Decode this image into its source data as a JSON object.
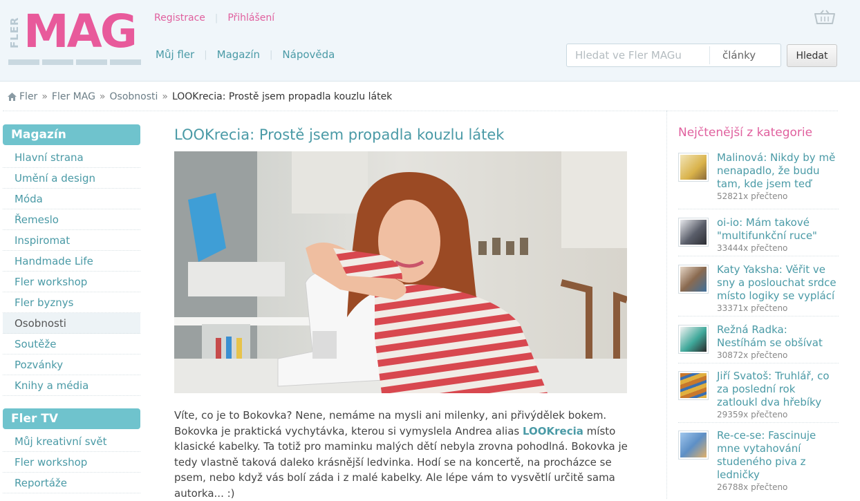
{
  "logo": {
    "small": "FLER",
    "big": "MAG"
  },
  "header": {
    "top_links": [
      "Registrace",
      "Přihlášení"
    ],
    "nav": [
      "Můj fler",
      "Magazín",
      "Nápověda"
    ],
    "search_placeholder": "Hledat ve Fler MAGu",
    "search_scope": "články",
    "search_button": "Hledat",
    "cart_icon": "basket-icon"
  },
  "breadcrumb": {
    "items": [
      "Fler",
      "Fler MAG",
      "Osobnosti"
    ],
    "current": "LOOKrecia: Prostě jsem propadla kouzlu látek",
    "separator": "»"
  },
  "sidebar": {
    "magazine": {
      "title": "Magazín",
      "items": [
        "Hlavní strana",
        "Umění a design",
        "Móda",
        "Řemeslo",
        "Inspiromat",
        "Handmade Life",
        "Fler workshop",
        "Fler byznys",
        "Osobnosti",
        "Soutěže",
        "Pozvánky",
        "Knihy a média"
      ],
      "active": "Osobnosti"
    },
    "tv": {
      "title": "Fler TV",
      "items": [
        "Můj kreativní svět",
        "Fler workshop",
        "Reportáže"
      ]
    }
  },
  "article": {
    "title": "LOOKrecia: Prostě jsem propadla kouzlu látek",
    "body_1": "Víte, co je to Bokovka? Nene, nemáme na mysli ani milenky, ani přivýdělek bokem. Bokovka je praktická vychytávka, kterou si vymyslela Andrea alias ",
    "body_author": "LOOKrecia",
    "body_2": " místo klasické kabelky. Ta totiž pro maminku malých dětí nebyla zrovna pohodlná. Bokovka je tedy vlastně taková daleko krásnější ledvinka. Hodí se na koncertě, na procházce se psem, nebo když vás bolí záda i z malé kabelky. Ale lépe vám to vysvětlí určitě sama autorka... :)"
  },
  "popular": {
    "title": "Nejčtenější z kategorie",
    "items": [
      {
        "title": "Malinová: Nikdy by mě nenapadlo, že budu tam, kde jsem teď",
        "count": "52821x přečteno",
        "color": "#d9b24a"
      },
      {
        "title": "oi-io: Mám takové \"multifunkční ruce\"",
        "count": "33444x přečteno",
        "color": "#5a5e6a"
      },
      {
        "title": "Katy Yaksha: Věřit ve sny a poslouchat srdce místo logiky se vyplácí",
        "count": "33371x přečteno",
        "color": "#8a6a50"
      },
      {
        "title": "Režná Radka: Nestíhám se obšívat",
        "count": "30872x přečteno",
        "color": "#3fa89a"
      },
      {
        "title": "Jiří Svatoš: Truhlář, co za poslední rok zatloukl dva hřebíky",
        "count": "29359x přečteno",
        "color": "#c8782c"
      },
      {
        "title": "Re-ce-se: Fascinuje mne vytahování studeného piva z ledničky",
        "count": "26788x přečteno",
        "color": "#5d8fc6"
      }
    ]
  }
}
